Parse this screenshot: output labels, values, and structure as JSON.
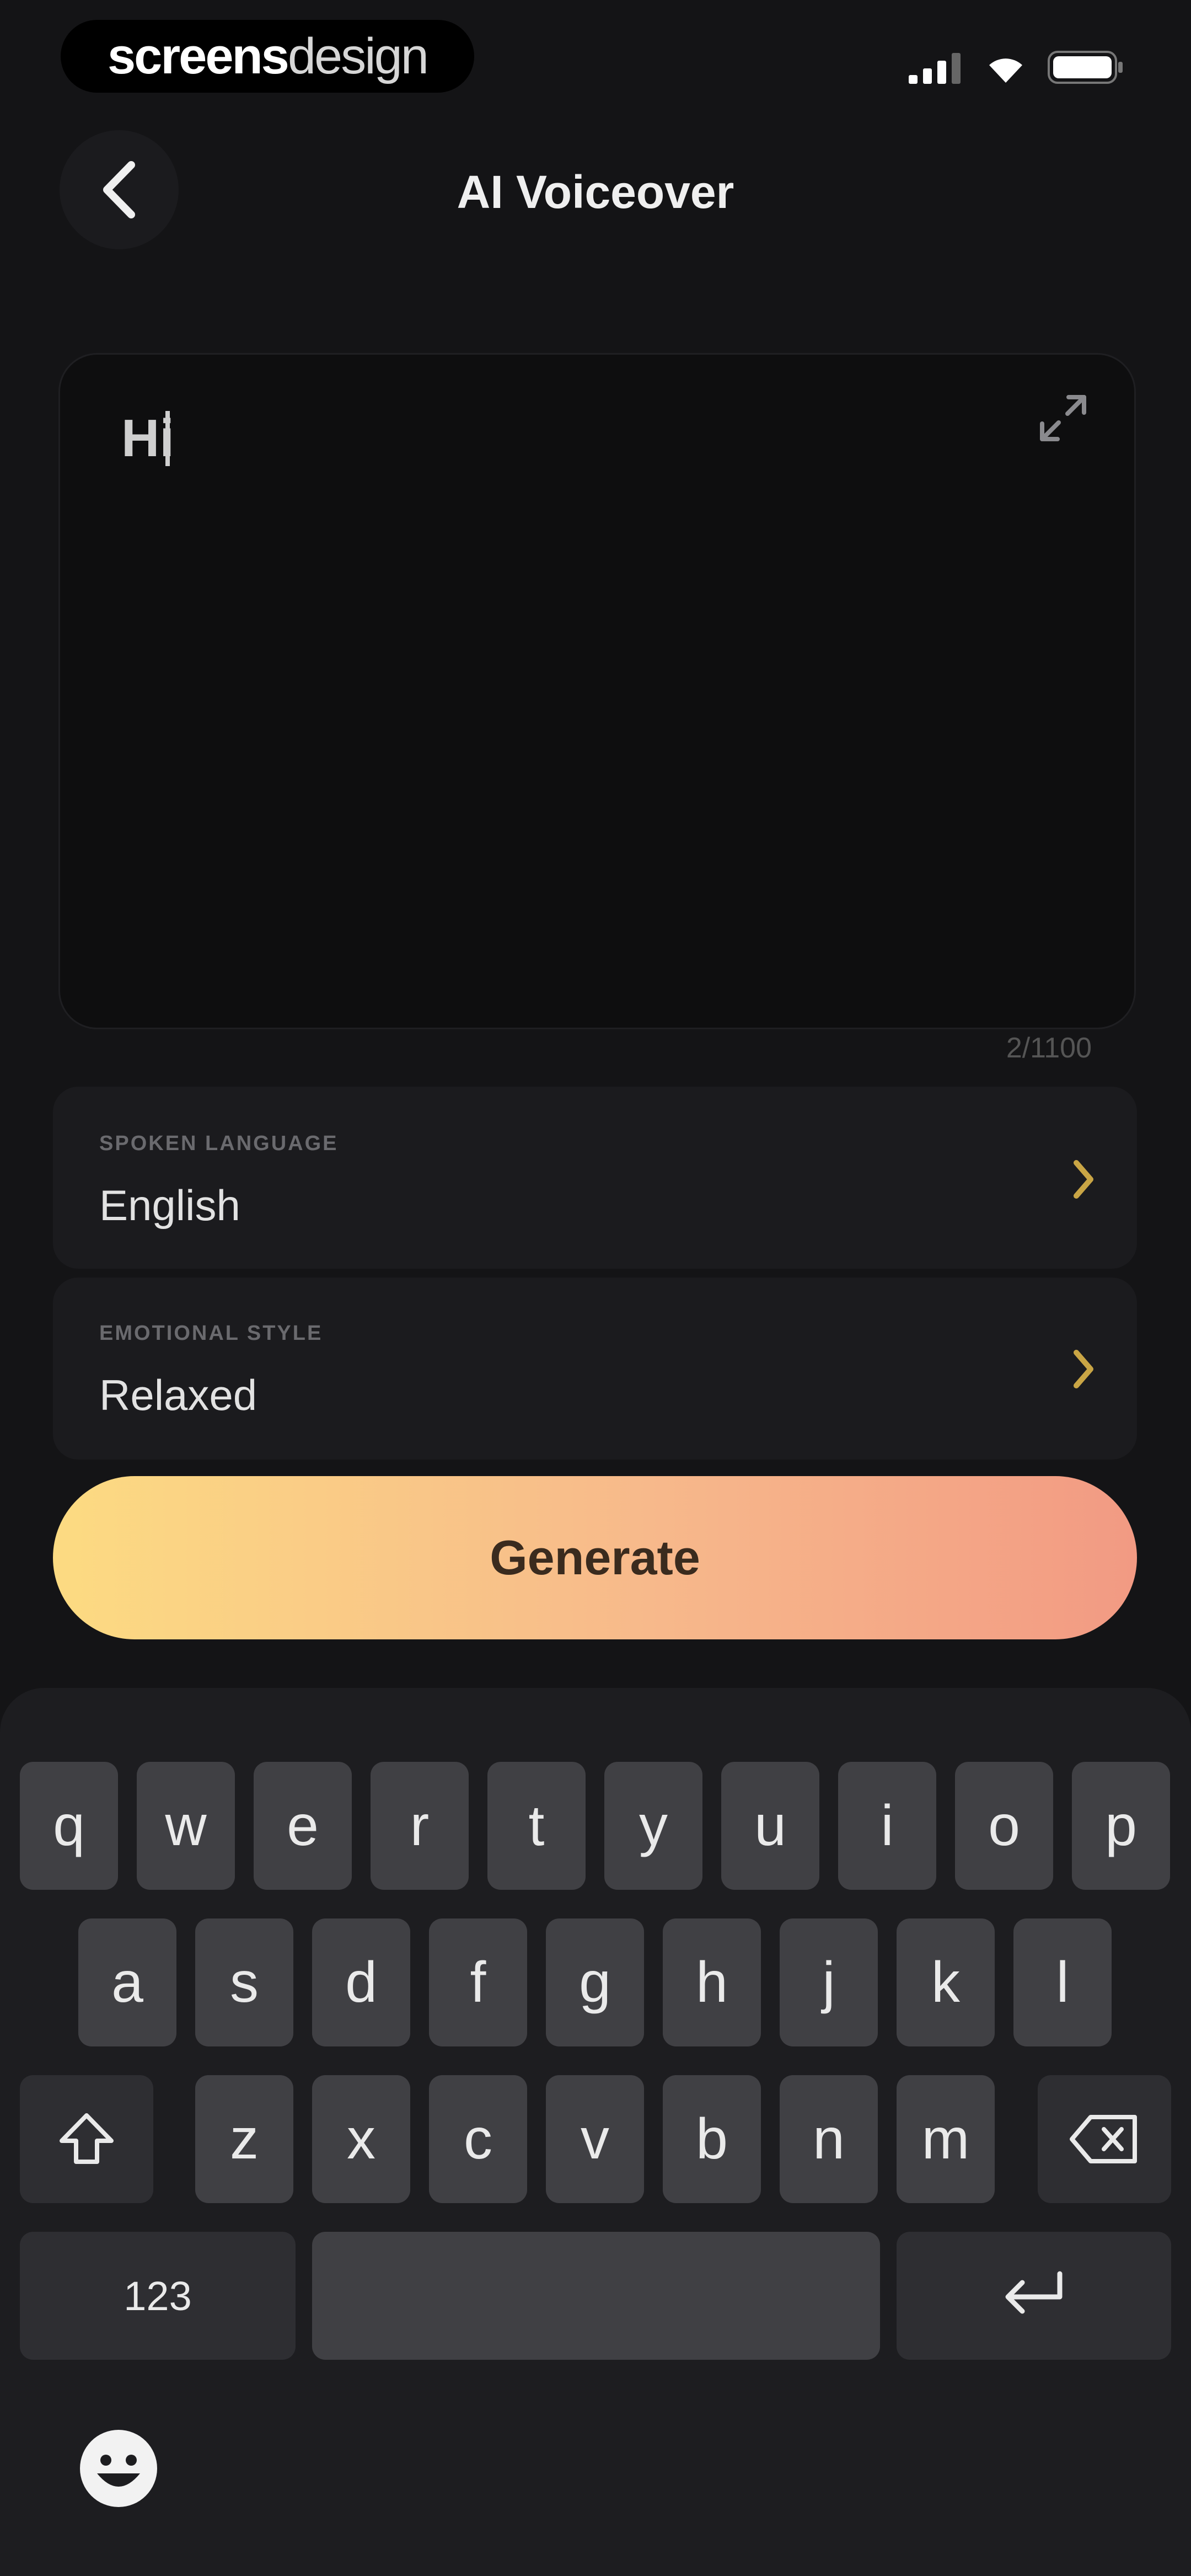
{
  "status_bar": {
    "brand_bold": "screens",
    "brand_light": "design",
    "icons": [
      "signal-icon",
      "wifi-icon",
      "battery-icon"
    ]
  },
  "nav": {
    "title": "AI Voiceover",
    "back_icon": "chevron-left-icon"
  },
  "editor": {
    "value": "Hi",
    "char_count": "2/1100",
    "expand_icon": "expand-icon"
  },
  "options": [
    {
      "label": "Spoken Language",
      "value": "English"
    },
    {
      "label": "Emotional Style",
      "value": "Relaxed"
    }
  ],
  "generate": {
    "label": "Generate"
  },
  "keyboard": {
    "row1": [
      "q",
      "w",
      "e",
      "r",
      "t",
      "y",
      "u",
      "i",
      "o",
      "p"
    ],
    "row2": [
      "a",
      "s",
      "d",
      "f",
      "g",
      "h",
      "j",
      "k",
      "l"
    ],
    "row3": [
      "z",
      "x",
      "c",
      "v",
      "b",
      "n",
      "m"
    ],
    "numbers_label": "123",
    "emoji_icon": "emoji-icon"
  },
  "colors": {
    "background": "#141416",
    "accent_start": "#FCDB82",
    "accent_end": "#F29A83",
    "chevron": "#C9A545"
  }
}
